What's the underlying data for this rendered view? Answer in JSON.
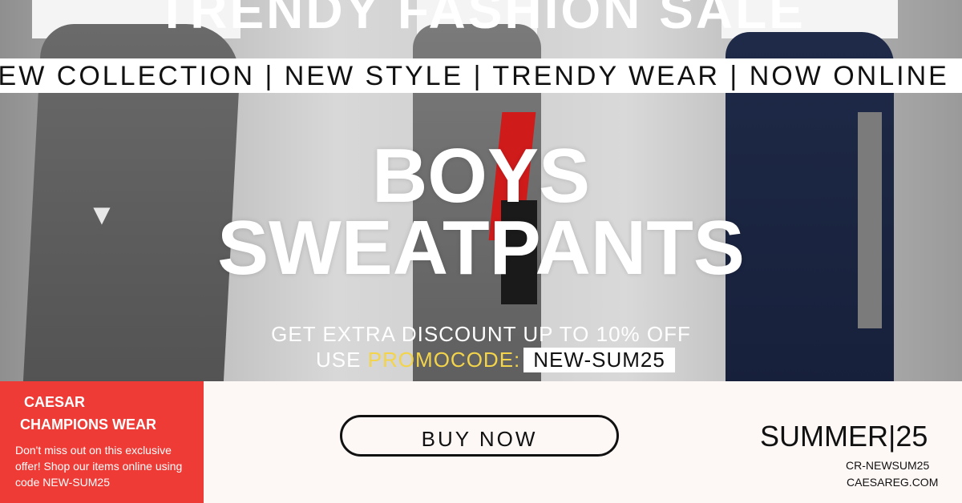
{
  "banner": {
    "top_title": "TRENDY FASHION SALE",
    "ticker": "NEW COLLECTION | NEW STYLE | TRENDY WEAR | NOW ONLINE",
    "headline_line1": "BOYS",
    "headline_line2": "SWEATPANTS",
    "promo_line1": "GET EXTRA DISCOUNT UP TO 10% OFF",
    "promo_prefix": "USE ",
    "promo_label": "PROMOCODE:",
    "promo_code": "NEW-SUM25"
  },
  "brand": {
    "name_line1": "CAESAR",
    "name_line2": "CHAMPIONS WEAR",
    "offer_text": "Don't miss out on this exclusive offer! Shop our items online using code NEW-SUM25"
  },
  "cta": {
    "buy_now_label": "BUY NOW"
  },
  "campaign": {
    "season": "SUMMER|25",
    "code": "CR-NEWSUM25",
    "website": "CAESAREG.COM"
  },
  "colors": {
    "accent_red": "#ef3b36",
    "promo_yellow": "#f3d44a",
    "bottom_bg": "#fdf8f6"
  }
}
